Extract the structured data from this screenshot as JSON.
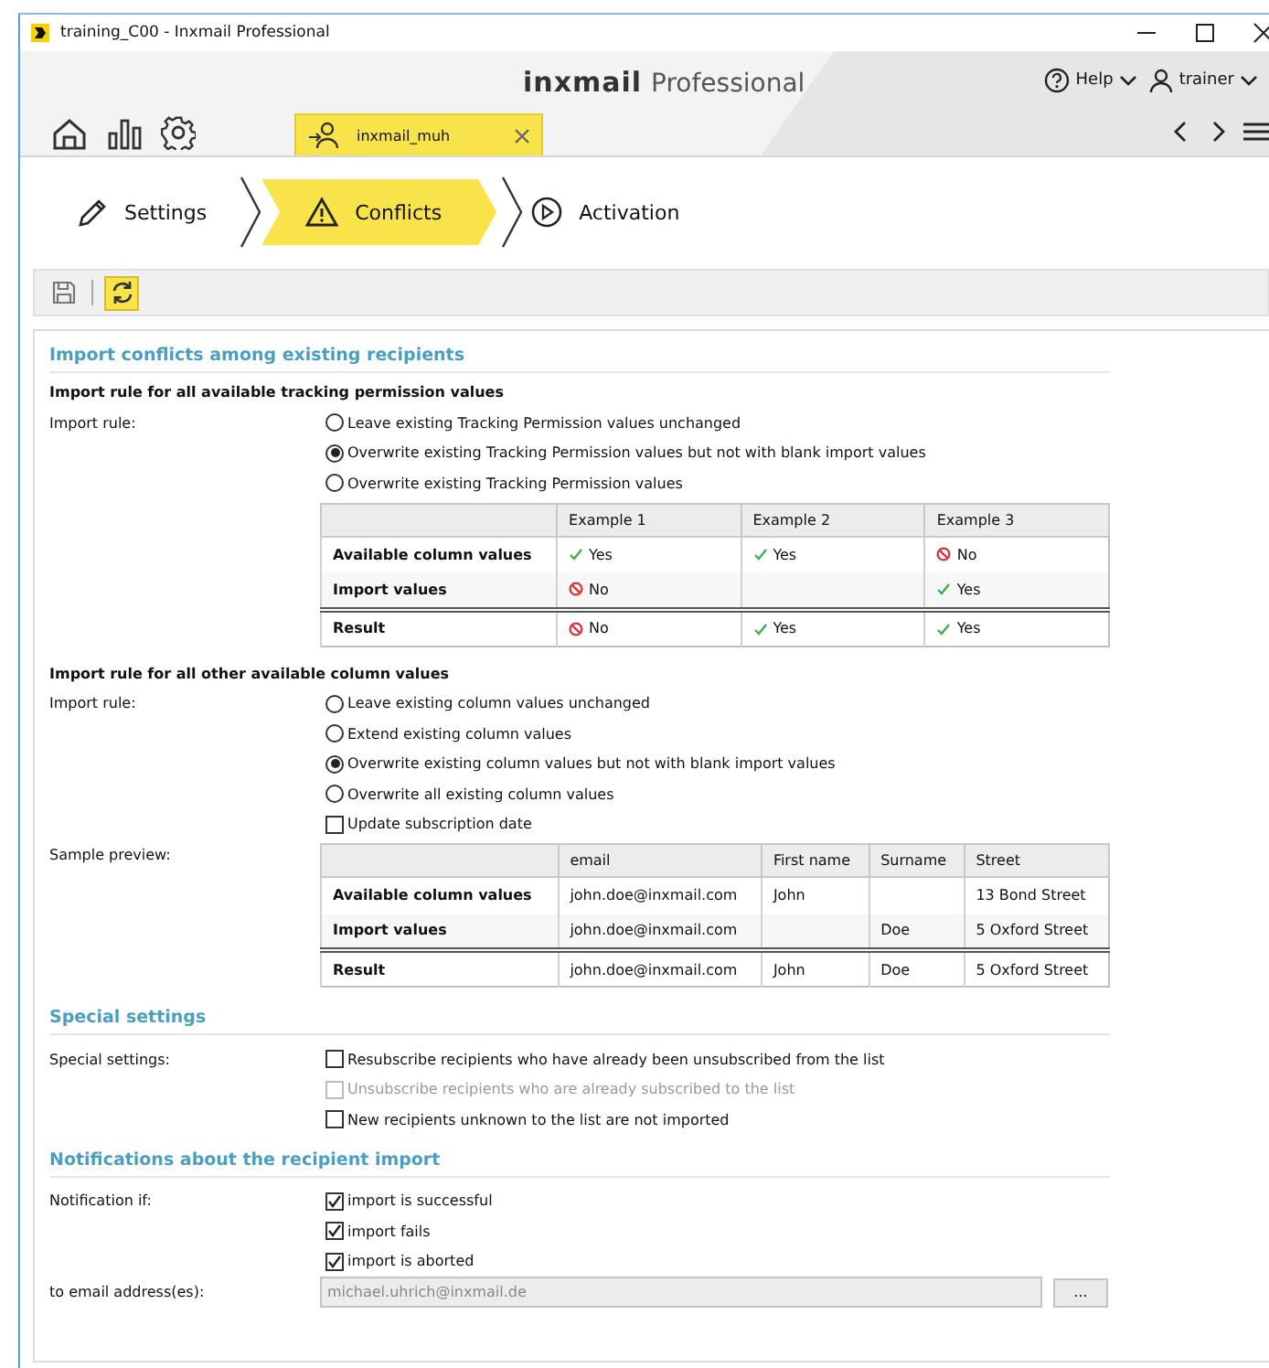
{
  "window": {
    "title": "training_C00 - Inxmail Professional"
  },
  "header": {
    "brand_bold": "inxmail",
    "brand": "Professional",
    "help": "Help",
    "user": "trainer"
  },
  "open_tab": {
    "label": "inxmail_muh"
  },
  "steps": [
    {
      "label": "Settings",
      "selected": false
    },
    {
      "label": "Conflicts",
      "selected": true
    },
    {
      "label": "Activation",
      "selected": false
    }
  ],
  "toolbar": [
    {
      "kind": "save",
      "selected": false
    },
    {
      "kind": "refresh",
      "selected": true
    }
  ],
  "tracking": {
    "section": "Import conflicts among existing recipients",
    "heading": "Import rule for all available tracking permission values",
    "label": "Import rule:",
    "options": [
      {
        "label": "Leave existing Tracking Permission values unchanged",
        "selected": false
      },
      {
        "label": "Overwrite existing Tracking Permission values but not with blank import values",
        "selected": true
      },
      {
        "label": "Overwrite existing Tracking Permission values",
        "selected": false
      }
    ],
    "table": {
      "columns": [
        "Example 1",
        "Example 2",
        "Example 3"
      ],
      "rows": [
        {
          "kind": "value",
          "label": "Available column values",
          "cells": [
            {
              "text": "Yes",
              "kind": "yes"
            },
            {
              "text": "Yes",
              "kind": "yes"
            },
            {
              "text": "No",
              "kind": "no"
            }
          ]
        },
        {
          "kind": "value",
          "label": "Import values",
          "cells": [
            {
              "text": "No",
              "kind": "no"
            },
            null,
            {
              "text": "Yes",
              "kind": "yes"
            }
          ]
        },
        {
          "kind": "result",
          "label": "Result",
          "cells": [
            {
              "text": "No",
              "kind": "no"
            },
            {
              "text": "Yes",
              "kind": "yes"
            },
            {
              "text": "Yes",
              "kind": "yes"
            }
          ]
        }
      ]
    }
  },
  "columns_rule": {
    "heading": "Import rule for all other available column values",
    "label": "Import rule:",
    "options": [
      {
        "label": "Leave existing column values unchanged",
        "selected": false
      },
      {
        "label": "Extend existing column values",
        "selected": false
      },
      {
        "label": "Overwrite existing column values but not with blank import values",
        "selected": true
      },
      {
        "label": "Overwrite all existing column values",
        "selected": false
      }
    ],
    "checkbox": {
      "label": "Update subscription date",
      "checked": false
    },
    "preview_label": "Sample preview:",
    "table": {
      "columns": [
        "email",
        "First name",
        "Surname",
        "Street"
      ],
      "rows": [
        {
          "kind": "value",
          "label": "Available column values",
          "cells": [
            {
              "text": "john.doe@inxmail.com"
            },
            {
              "text": "John"
            },
            null,
            {
              "text": "13 Bond Street"
            }
          ]
        },
        {
          "kind": "value",
          "label": "Import values",
          "cells": [
            {
              "text": "john.doe@inxmail.com"
            },
            null,
            {
              "text": "Doe"
            },
            {
              "text": "5 Oxford Street"
            }
          ]
        },
        {
          "kind": "result",
          "label": "Result",
          "cells": [
            {
              "text": "john.doe@inxmail.com"
            },
            {
              "text": "John"
            },
            {
              "text": "Doe"
            },
            {
              "text": "5 Oxford Street"
            }
          ]
        }
      ]
    }
  },
  "special": {
    "section": "Special settings",
    "label": "Special settings:",
    "options": [
      {
        "label": "Resubscribe recipients who have already been unsubscribed from the list",
        "checked": false,
        "disabled": false
      },
      {
        "label": "Unsubscribe recipients who are already subscribed to the list",
        "checked": false,
        "disabled": true
      },
      {
        "label": "New recipients unknown to the list are not imported",
        "checked": false,
        "disabled": false
      }
    ]
  },
  "notifications": {
    "section": "Notifications about the recipient import",
    "label": "Notification if:",
    "options": [
      {
        "label": "import is successful",
        "checked": true
      },
      {
        "label": "import fails",
        "checked": true
      },
      {
        "label": "import is aborted",
        "checked": true
      }
    ],
    "email_label": "to email address(es):",
    "email_value": "michael.uhrich@inxmail.de",
    "email_disabled": true,
    "browse": "..."
  }
}
